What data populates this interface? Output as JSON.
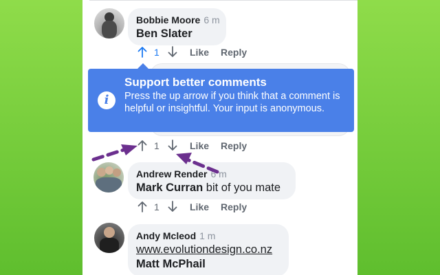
{
  "comments": [
    {
      "author": "Bobbie Moore",
      "time": "6 m",
      "mention": "Ben Slater",
      "text": "",
      "link": "",
      "vote_count": "1",
      "vote_active": true,
      "like_label": "Like",
      "reply_label": "Reply"
    },
    {
      "vote_count": "1",
      "like_label": "Like",
      "reply_label": "Reply"
    },
    {
      "author": "Andrew Render",
      "time": "6 m",
      "mention": "Mark Curran",
      "text": " bit of you mate",
      "vote_count": "1",
      "like_label": "Like",
      "reply_label": "Reply"
    },
    {
      "author": "Andy Mcleod",
      "time": "1 m",
      "link": "www.evolutiondesign.co.nz",
      "mention": "Matt McPhail"
    }
  ],
  "tooltip": {
    "title": "Support better comments",
    "body": "Press the up arrow if you think that a comment is helpful or insightful. Your input is anonymous.",
    "icon": "info-icon"
  },
  "colors": {
    "background": "#6cc93a",
    "tooltip": "#4a80e8",
    "vote_active": "#1877f2",
    "annotation_arrow": "#6b2f8e"
  }
}
